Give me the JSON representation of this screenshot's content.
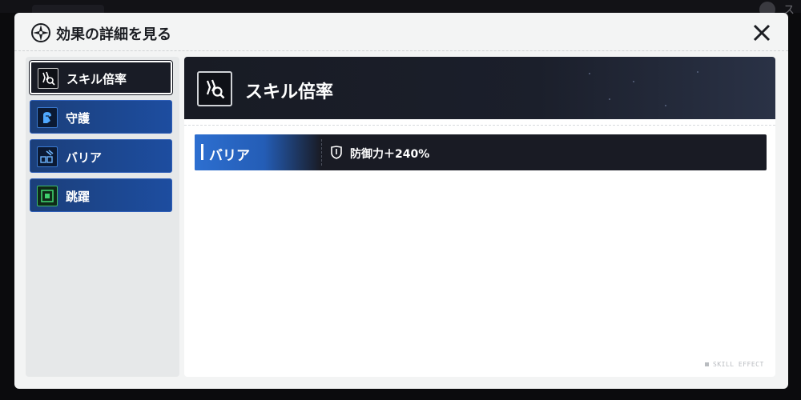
{
  "background": {
    "right_text": "ス"
  },
  "modal": {
    "title": "効果の詳細を見る",
    "close_icon": "close-icon"
  },
  "sidebar": {
    "items": [
      {
        "label": "スキル倍率",
        "icon": "skill-multiplier-icon",
        "active": true
      },
      {
        "label": "守護",
        "icon": "guard-icon",
        "active": false
      },
      {
        "label": "バリア",
        "icon": "barrier-icon",
        "active": false
      },
      {
        "label": "跳躍",
        "icon": "leap-icon",
        "active": false
      }
    ]
  },
  "content": {
    "title": "スキル倍率",
    "icon": "skill-multiplier-icon",
    "effects": [
      {
        "label": "バリア",
        "icon": "shield-icon",
        "value": "防御力＋240%"
      }
    ],
    "watermark": "SKILL EFFECT"
  },
  "colors": {
    "accent_blue": "#2d6fd0",
    "tab_blue": "#1d4da0",
    "dark_panel": "#191b24",
    "modal_bg": "#f3f4f4"
  }
}
